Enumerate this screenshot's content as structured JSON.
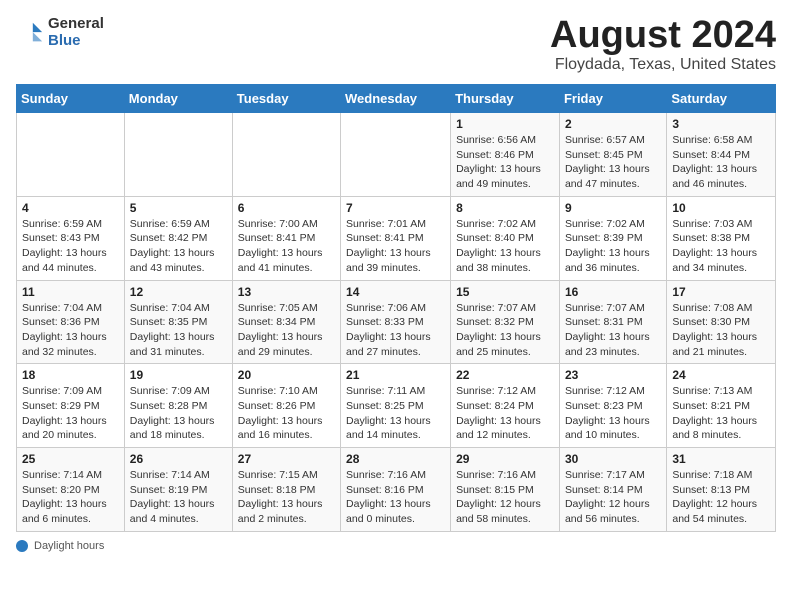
{
  "logo": {
    "general": "General",
    "blue": "Blue"
  },
  "title": "August 2024",
  "subtitle": "Floydada, Texas, United States",
  "days_of_week": [
    "Sunday",
    "Monday",
    "Tuesday",
    "Wednesday",
    "Thursday",
    "Friday",
    "Saturday"
  ],
  "footer": {
    "label": "Daylight hours"
  },
  "weeks": [
    [
      {
        "day": "",
        "info": ""
      },
      {
        "day": "",
        "info": ""
      },
      {
        "day": "",
        "info": ""
      },
      {
        "day": "",
        "info": ""
      },
      {
        "day": "1",
        "info": "Sunrise: 6:56 AM\nSunset: 8:46 PM\nDaylight: 13 hours and 49 minutes."
      },
      {
        "day": "2",
        "info": "Sunrise: 6:57 AM\nSunset: 8:45 PM\nDaylight: 13 hours and 47 minutes."
      },
      {
        "day": "3",
        "info": "Sunrise: 6:58 AM\nSunset: 8:44 PM\nDaylight: 13 hours and 46 minutes."
      }
    ],
    [
      {
        "day": "4",
        "info": "Sunrise: 6:59 AM\nSunset: 8:43 PM\nDaylight: 13 hours and 44 minutes."
      },
      {
        "day": "5",
        "info": "Sunrise: 6:59 AM\nSunset: 8:42 PM\nDaylight: 13 hours and 43 minutes."
      },
      {
        "day": "6",
        "info": "Sunrise: 7:00 AM\nSunset: 8:41 PM\nDaylight: 13 hours and 41 minutes."
      },
      {
        "day": "7",
        "info": "Sunrise: 7:01 AM\nSunset: 8:41 PM\nDaylight: 13 hours and 39 minutes."
      },
      {
        "day": "8",
        "info": "Sunrise: 7:02 AM\nSunset: 8:40 PM\nDaylight: 13 hours and 38 minutes."
      },
      {
        "day": "9",
        "info": "Sunrise: 7:02 AM\nSunset: 8:39 PM\nDaylight: 13 hours and 36 minutes."
      },
      {
        "day": "10",
        "info": "Sunrise: 7:03 AM\nSunset: 8:38 PM\nDaylight: 13 hours and 34 minutes."
      }
    ],
    [
      {
        "day": "11",
        "info": "Sunrise: 7:04 AM\nSunset: 8:36 PM\nDaylight: 13 hours and 32 minutes."
      },
      {
        "day": "12",
        "info": "Sunrise: 7:04 AM\nSunset: 8:35 PM\nDaylight: 13 hours and 31 minutes."
      },
      {
        "day": "13",
        "info": "Sunrise: 7:05 AM\nSunset: 8:34 PM\nDaylight: 13 hours and 29 minutes."
      },
      {
        "day": "14",
        "info": "Sunrise: 7:06 AM\nSunset: 8:33 PM\nDaylight: 13 hours and 27 minutes."
      },
      {
        "day": "15",
        "info": "Sunrise: 7:07 AM\nSunset: 8:32 PM\nDaylight: 13 hours and 25 minutes."
      },
      {
        "day": "16",
        "info": "Sunrise: 7:07 AM\nSunset: 8:31 PM\nDaylight: 13 hours and 23 minutes."
      },
      {
        "day": "17",
        "info": "Sunrise: 7:08 AM\nSunset: 8:30 PM\nDaylight: 13 hours and 21 minutes."
      }
    ],
    [
      {
        "day": "18",
        "info": "Sunrise: 7:09 AM\nSunset: 8:29 PM\nDaylight: 13 hours and 20 minutes."
      },
      {
        "day": "19",
        "info": "Sunrise: 7:09 AM\nSunset: 8:28 PM\nDaylight: 13 hours and 18 minutes."
      },
      {
        "day": "20",
        "info": "Sunrise: 7:10 AM\nSunset: 8:26 PM\nDaylight: 13 hours and 16 minutes."
      },
      {
        "day": "21",
        "info": "Sunrise: 7:11 AM\nSunset: 8:25 PM\nDaylight: 13 hours and 14 minutes."
      },
      {
        "day": "22",
        "info": "Sunrise: 7:12 AM\nSunset: 8:24 PM\nDaylight: 13 hours and 12 minutes."
      },
      {
        "day": "23",
        "info": "Sunrise: 7:12 AM\nSunset: 8:23 PM\nDaylight: 13 hours and 10 minutes."
      },
      {
        "day": "24",
        "info": "Sunrise: 7:13 AM\nSunset: 8:21 PM\nDaylight: 13 hours and 8 minutes."
      }
    ],
    [
      {
        "day": "25",
        "info": "Sunrise: 7:14 AM\nSunset: 8:20 PM\nDaylight: 13 hours and 6 minutes."
      },
      {
        "day": "26",
        "info": "Sunrise: 7:14 AM\nSunset: 8:19 PM\nDaylight: 13 hours and 4 minutes."
      },
      {
        "day": "27",
        "info": "Sunrise: 7:15 AM\nSunset: 8:18 PM\nDaylight: 13 hours and 2 minutes."
      },
      {
        "day": "28",
        "info": "Sunrise: 7:16 AM\nSunset: 8:16 PM\nDaylight: 13 hours and 0 minutes."
      },
      {
        "day": "29",
        "info": "Sunrise: 7:16 AM\nSunset: 8:15 PM\nDaylight: 12 hours and 58 minutes."
      },
      {
        "day": "30",
        "info": "Sunrise: 7:17 AM\nSunset: 8:14 PM\nDaylight: 12 hours and 56 minutes."
      },
      {
        "day": "31",
        "info": "Sunrise: 7:18 AM\nSunset: 8:13 PM\nDaylight: 12 hours and 54 minutes."
      }
    ]
  ]
}
